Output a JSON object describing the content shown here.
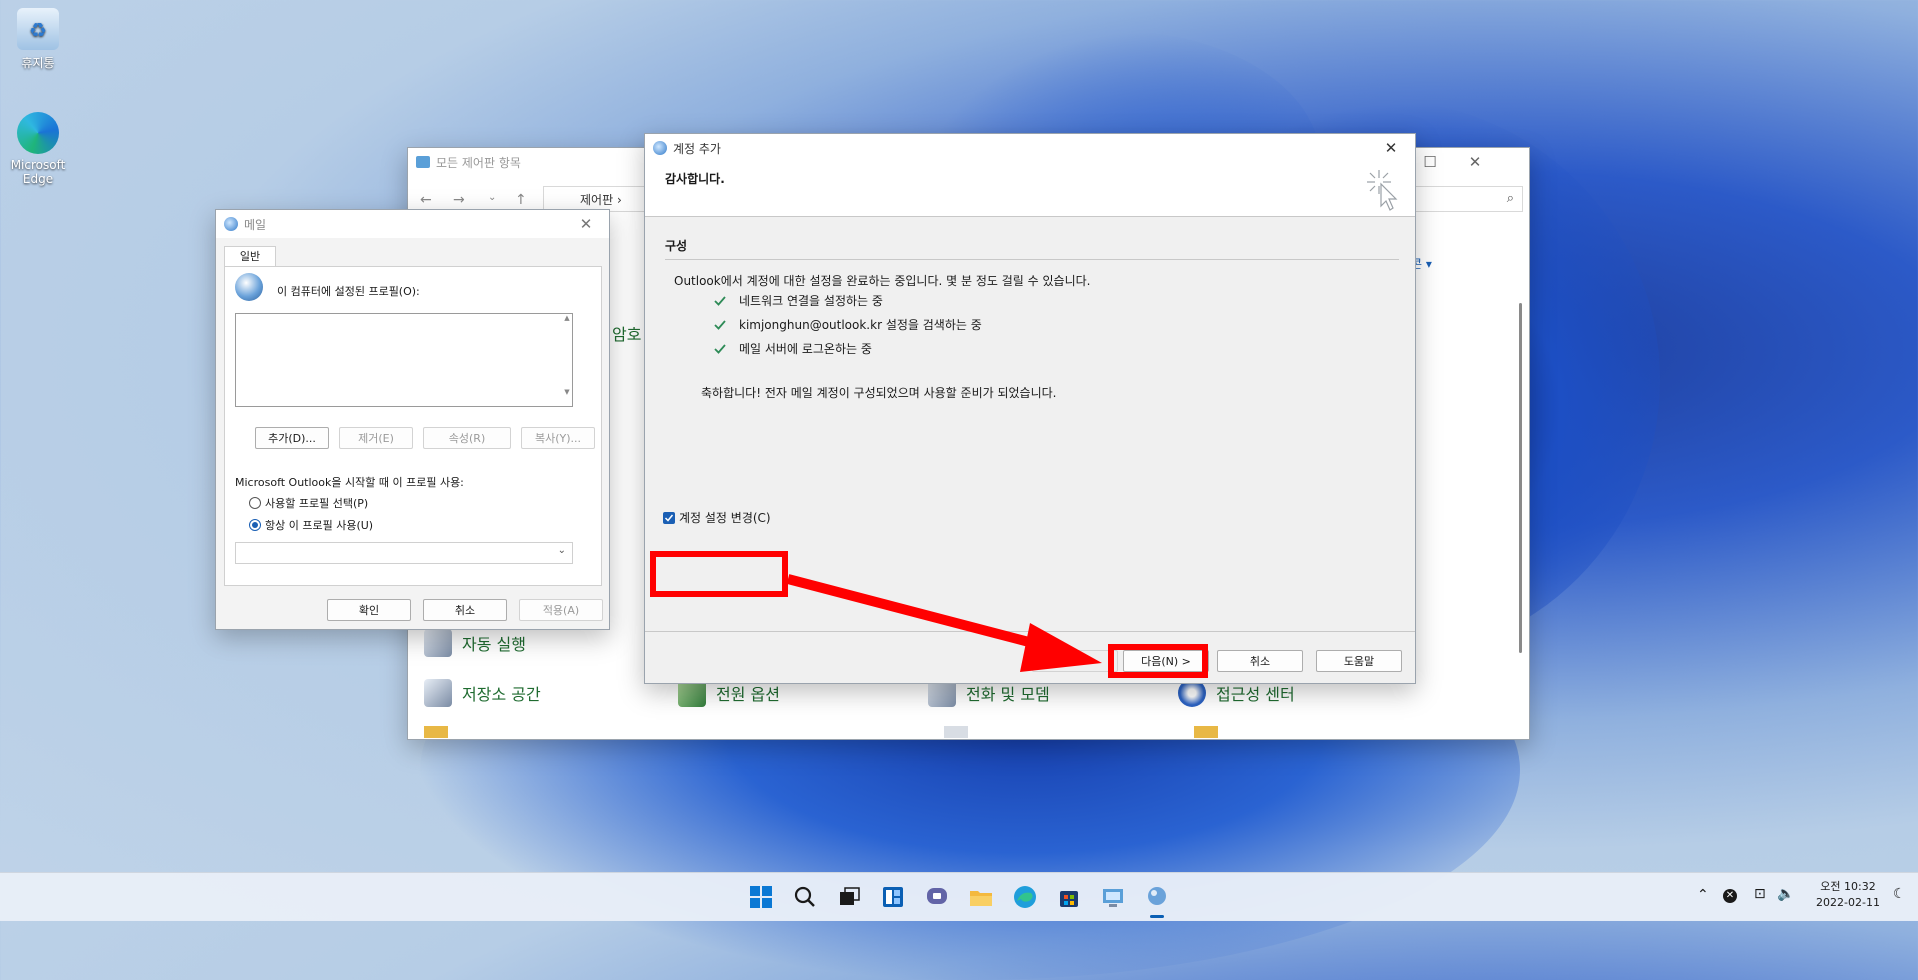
{
  "desktop": {
    "recycle_bin": "휴지통",
    "edge_line1": "Microsoft",
    "edge_line2": "Edge"
  },
  "control_panel": {
    "title": "모든 제어판 항목",
    "breadcrumb": "제어판",
    "view_by": "콘",
    "partial_item": "암호",
    "items": {
      "autoplay": "자동 실행",
      "storage": "저장소 공간",
      "power": "전원 옵션",
      "phone_modem": "전화 및 모뎀",
      "accessibility": "접근성 센터"
    }
  },
  "mail_dialog": {
    "title": "메일",
    "tab_general": "일반",
    "profiles_label": "이 컴퓨터에 설정된 프로필(O):",
    "btn_add": "추가(D)...",
    "btn_remove": "제거(E)",
    "btn_properties": "속성(R)",
    "btn_copy": "복사(Y)...",
    "startup_label": "Microsoft Outlook을 시작할 때 이 프로필 사용:",
    "radio_prompt": "사용할 프로필 선택(P)",
    "radio_always": "항상 이 프로필 사용(U)",
    "btn_ok": "확인",
    "btn_cancel": "취소",
    "btn_apply": "적용(A)"
  },
  "add_account": {
    "title": "계정 추가",
    "header": "감사합니다.",
    "section": "구성",
    "intro": "Outlook에서 계정에 대한 설정을 완료하는 중입니다. 몇 분 정도 걸릴 수 있습니다.",
    "steps": [
      "네트워크 연결을 설정하는 중",
      "kimjonghun@outlook.kr 설정을 검색하는 중",
      "메일 서버에 로그온하는 중"
    ],
    "congrats": "축하합니다! 전자 메일 계정이 구성되었으며 사용할 준비가 되었습니다.",
    "change_settings": "계정 설정 변경(C)",
    "btn_back": "<",
    "btn_next": "다음(N) >",
    "btn_cancel": "취소",
    "btn_help": "도움말"
  },
  "taskbar": {
    "time": "오전 10:32",
    "date": "2022-02-11"
  },
  "colors": {
    "highlight": "#ff0000",
    "check_green": "#2e8b57",
    "link_green": "#1f6b30"
  }
}
